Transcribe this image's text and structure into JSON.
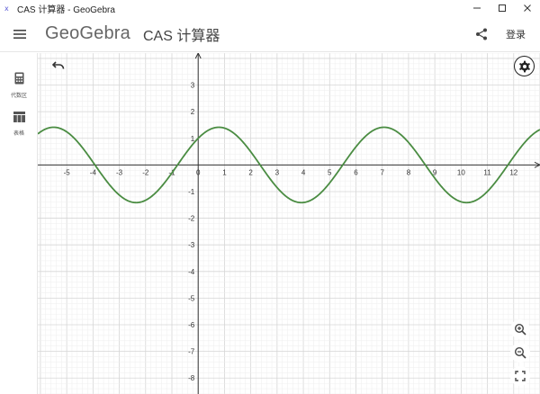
{
  "window": {
    "title": "CAS 计算器 - GeoGebra",
    "controls": [
      "minimize",
      "maximize",
      "close"
    ]
  },
  "header": {
    "menu_icon": "hamburger-menu-icon",
    "logo": "GeoGebra",
    "app_name": "CAS 计算器",
    "share_icon": "share-icon",
    "login_label": "登录"
  },
  "sidebar": {
    "items": [
      {
        "label": "代数区",
        "icon": "calculator-icon"
      },
      {
        "label": "表格",
        "icon": "table-icon"
      }
    ]
  },
  "toolbar": {
    "undo_icon": "undo-icon",
    "settings_icon": "gear-icon",
    "zoom_in_icon": "zoom-in-icon",
    "zoom_out_icon": "zoom-out-icon",
    "fullscreen_icon": "fullscreen-icon"
  },
  "colors": {
    "curve": "#4a8c42",
    "axis": "#333333",
    "grid_major": "#d6d6d6",
    "grid_minor": "#eeeeee"
  },
  "chart_data": {
    "type": "line",
    "series": [
      {
        "function": "sin(x) + cos(x)",
        "amplitude": 1.414,
        "period": 6.283,
        "x_range": [
          -6.1,
          13.0
        ]
      }
    ],
    "xlim": [
      -6.1,
      13.0
    ],
    "ylim": [
      -8.6,
      4.2
    ],
    "x_tick_labels": [
      "-5",
      "-4",
      "-3",
      "-2",
      "-1",
      "0",
      "1",
      "2",
      "3",
      "4",
      "5",
      "6",
      "7",
      "8",
      "9",
      "10",
      "11",
      "12"
    ],
    "y_tick_labels": [
      "3",
      "2",
      "1",
      "-1",
      "-2",
      "-3",
      "-4",
      "-5",
      "-6",
      "-7",
      "-8"
    ],
    "grid": true
  }
}
